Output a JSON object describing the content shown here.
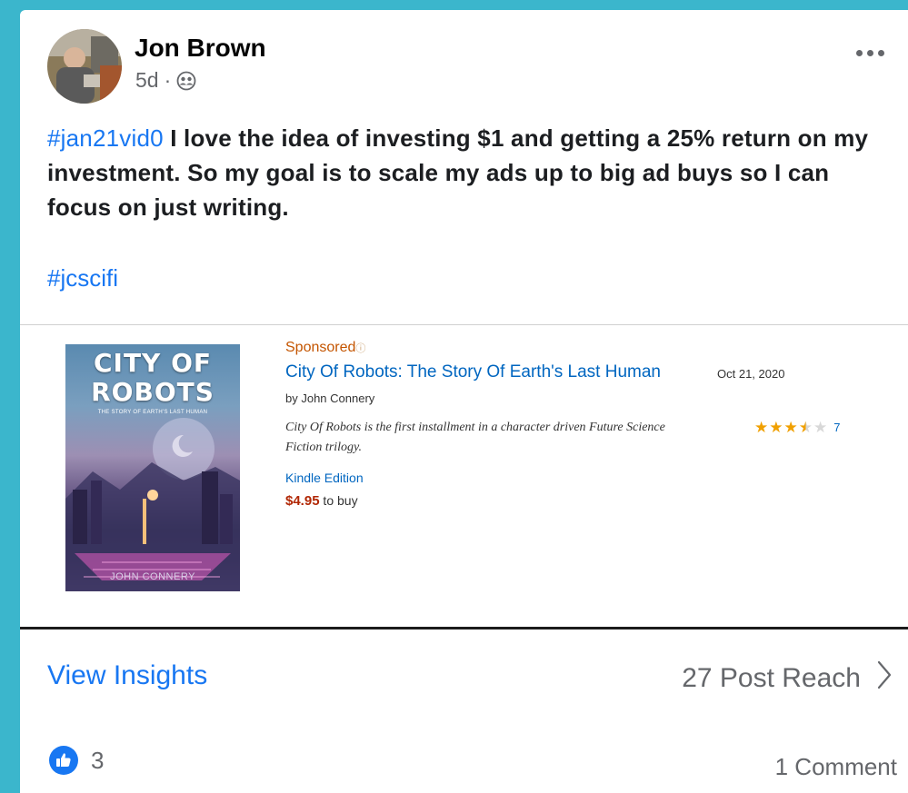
{
  "post": {
    "author": "Jon Brown",
    "time": "5d",
    "separator": "·",
    "audience_icon": "friends-icon",
    "more_icon": "more-dots-icon",
    "hashtag1": "#jan21vid0",
    "body": " I love the idea of investing $1 and getting a 25% return on my investment. So my goal is to scale my ads up to big ad buys so I can focus on just writing.",
    "hashtag2": "#jcscifi"
  },
  "ad": {
    "cover_title_line1": "CITY OF",
    "cover_title_line2": "ROBOTS",
    "cover_subtitle": "THE STORY OF EARTH'S LAST HUMAN",
    "cover_author": "JOHN CONNERY",
    "sponsored": "Sponsored",
    "info_icon": "ⓘ",
    "title": "City Of Robots: The Story Of Earth's Last Human",
    "date": "Oct 21, 2020",
    "by": "by John Connery",
    "description": "City Of Robots is the first installment in a character driven Future Science Fiction trilogy.",
    "rating": 3.5,
    "rating_count": "7",
    "edition": "Kindle Edition",
    "price": "$4.95",
    "price_suffix": " to buy"
  },
  "footer": {
    "view_insights": "View Insights",
    "post_reach": "27 Post Reach",
    "likes": "3",
    "comments": "1 Comment"
  },
  "colors": {
    "background": "#3bb6cc",
    "link_blue": "#1877f2",
    "amazon_link": "#0066c0",
    "sponsored_orange": "#c45500",
    "price_red": "#b12704",
    "star_gold": "#f0a000"
  }
}
